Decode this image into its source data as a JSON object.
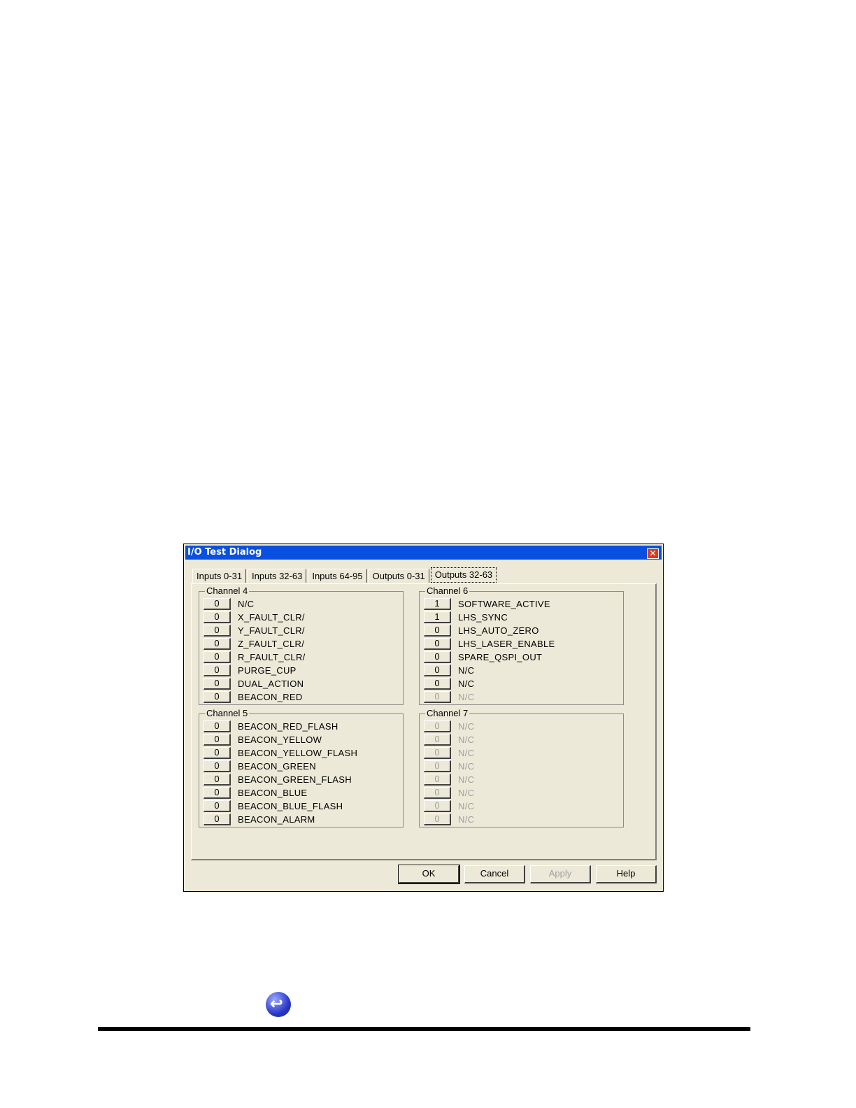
{
  "dialog": {
    "title": "I/O Test Dialog",
    "close_glyph": "✕",
    "tabs": [
      "Inputs 0-31",
      "Inputs 32-63",
      "Inputs 64-95",
      "Outputs 0-31",
      "Outputs 32-63"
    ],
    "active_tab": "Outputs 32-63",
    "groups": [
      {
        "title": "Channel 4",
        "rows": [
          {
            "value": "0",
            "label": "N/C"
          },
          {
            "value": "0",
            "label": "X_FAULT_CLR/"
          },
          {
            "value": "0",
            "label": "Y_FAULT_CLR/"
          },
          {
            "value": "0",
            "label": "Z_FAULT_CLR/"
          },
          {
            "value": "0",
            "label": "R_FAULT_CLR/"
          },
          {
            "value": "0",
            "label": "PURGE_CUP"
          },
          {
            "value": "0",
            "label": "DUAL_ACTION"
          },
          {
            "value": "0",
            "label": "BEACON_RED"
          }
        ]
      },
      {
        "title": "Channel 6",
        "rows": [
          {
            "value": "1",
            "label": "SOFTWARE_ACTIVE"
          },
          {
            "value": "1",
            "label": "LHS_SYNC"
          },
          {
            "value": "0",
            "label": "LHS_AUTO_ZERO"
          },
          {
            "value": "0",
            "label": "LHS_LASER_ENABLE"
          },
          {
            "value": "0",
            "label": "SPARE_QSPI_OUT"
          },
          {
            "value": "0",
            "label": "N/C"
          },
          {
            "value": "0",
            "label": "N/C"
          },
          {
            "value": "0",
            "label": "N/C",
            "disabled": true
          }
        ]
      },
      {
        "title": "Channel 5",
        "rows": [
          {
            "value": "0",
            "label": "BEACON_RED_FLASH"
          },
          {
            "value": "0",
            "label": "BEACON_YELLOW"
          },
          {
            "value": "0",
            "label": "BEACON_YELLOW_FLASH"
          },
          {
            "value": "0",
            "label": "BEACON_GREEN"
          },
          {
            "value": "0",
            "label": "BEACON_GREEN_FLASH"
          },
          {
            "value": "0",
            "label": "BEACON_BLUE"
          },
          {
            "value": "0",
            "label": "BEACON_BLUE_FLASH"
          },
          {
            "value": "0",
            "label": "BEACON_ALARM"
          }
        ]
      },
      {
        "title": "Channel 7",
        "rows": [
          {
            "value": "0",
            "label": "N/C",
            "disabled": true
          },
          {
            "value": "0",
            "label": "N/C",
            "disabled": true
          },
          {
            "value": "0",
            "label": "N/C",
            "disabled": true
          },
          {
            "value": "0",
            "label": "N/C",
            "disabled": true
          },
          {
            "value": "0",
            "label": "N/C",
            "disabled": true
          },
          {
            "value": "0",
            "label": "N/C",
            "disabled": true
          },
          {
            "value": "0",
            "label": "N/C",
            "disabled": true
          },
          {
            "value": "0",
            "label": "N/C",
            "disabled": true
          }
        ]
      }
    ],
    "buttons": {
      "ok": "OK",
      "cancel": "Cancel",
      "apply": "Apply",
      "help": "Help"
    }
  },
  "page": {
    "back_icon": "back-arrow-icon"
  }
}
